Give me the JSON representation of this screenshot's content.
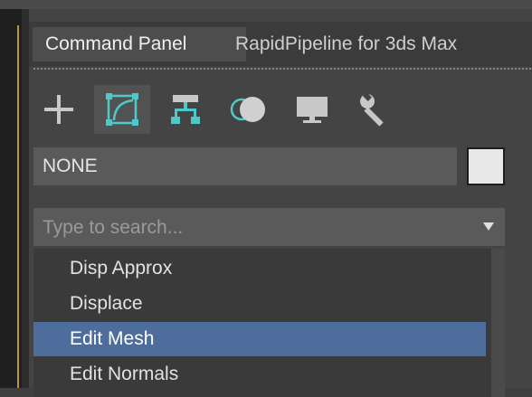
{
  "tabs": [
    {
      "label": "Command Panel",
      "active": true
    },
    {
      "label": "RapidPipeline for 3ds Max",
      "active": false
    }
  ],
  "toolbar": {
    "icons": [
      "plus-icon",
      "bent-curve-icon",
      "hierarchy-icon",
      "sphere-icon",
      "display-icon",
      "wrench-icon"
    ],
    "selected": "bent-curve-icon"
  },
  "object": {
    "name": "NONE",
    "color": "#e8e8e8"
  },
  "search": {
    "placeholder": "Type to search...",
    "value": ""
  },
  "modifier_list": {
    "items": [
      "Disp Approx",
      "Displace",
      "Edit Mesh",
      "Edit Normals"
    ],
    "selected": "Edit Mesh"
  },
  "colors": {
    "accent": "#4ec8c8",
    "selection": "#4d6e9c",
    "panel": "#444444"
  }
}
